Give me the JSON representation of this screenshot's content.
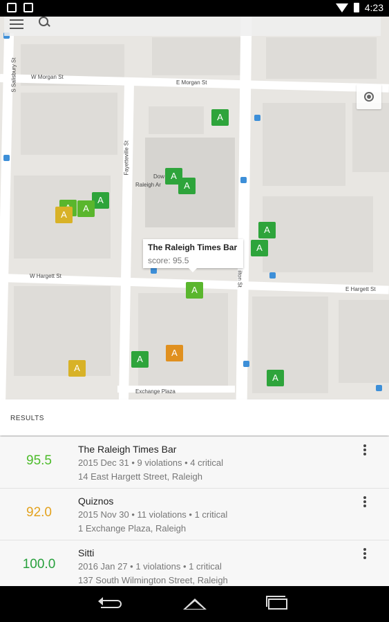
{
  "status_bar": {
    "time": "4:23"
  },
  "map": {
    "streets": {
      "morgan_w": "W Morgan St",
      "morgan_e": "E Morgan St",
      "hargett_w": "W Hargett St",
      "hargett_e": "E Hargett St",
      "salisbury": "S Salisbury St",
      "fayetteville": "Fayetteville St",
      "wilmington": "ilton St",
      "exchange": "Exchange Plaza",
      "downtown": "Dow",
      "raleigh": "Raleigh Ar"
    },
    "marker_label": "A",
    "info_window": {
      "title": "The Raleigh Times Bar",
      "score": "score: 95.5"
    }
  },
  "results": {
    "header": "RESULTS",
    "items": [
      {
        "score": "95.5",
        "score_color": "#4cbb2a",
        "name": "The Raleigh Times Bar",
        "meta": "2015 Dec 31 • 9 violations • 4 critical",
        "address": "14 East Hargett Street, Raleigh"
      },
      {
        "score": "92.0",
        "score_color": "#e3a21e",
        "name": "Quiznos",
        "meta": "2015 Nov 30 • 11 violations • 1 critical",
        "address": "1 Exchange Plaza, Raleigh"
      },
      {
        "score": "100.0",
        "score_color": "#27a03c",
        "name": "Sitti",
        "meta": "2016 Jan 27 • 1 violations • 1 critical",
        "address": "137 South Wilmington Street, Raleigh"
      }
    ]
  },
  "colors": {
    "marker_green": "#2ea43b",
    "marker_light_green": "#5ab62d",
    "marker_yellow": "#d8b227",
    "marker_orange": "#e0901f"
  }
}
